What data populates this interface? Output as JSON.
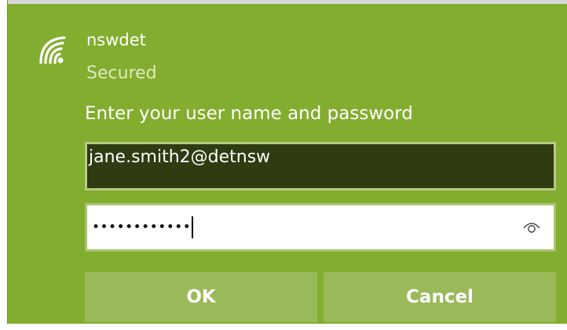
{
  "network": {
    "name": "nswdet",
    "status": "Secured",
    "icon": "wifi-icon"
  },
  "login": {
    "prompt": "Enter your user name and password",
    "username_value": "jane.smith2@detnsw",
    "password_mask": "••••••••••••",
    "reveal_icon": "eye-icon"
  },
  "buttons": {
    "ok_label": "OK",
    "cancel_label": "Cancel"
  },
  "colors": {
    "panel_bg": "#82ad2f",
    "username_bg": "#2f3b11",
    "button_bg": "#9ab958",
    "text": "#ffffff",
    "status_text": "#dfeac3"
  }
}
